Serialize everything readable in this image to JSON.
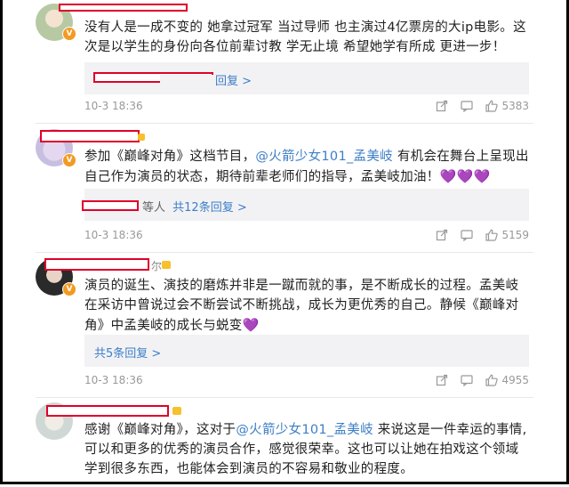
{
  "comments": [
    {
      "text": "没有人是一成不变的 她拿过冠军 当过导师 也主演过4亿票房的大ip电影。这次是以学生的身份向各位前辈讨教 学无止境 希望她学有所成 更进一步！",
      "reply_link": "等人 共79条回复 >",
      "time": "10-3 18:36",
      "likes": "5383"
    },
    {
      "text_pre": "参加《巅峰对角》这档节目，",
      "mention": "@火箭少女101_孟美岐",
      "text_post": " 有机会在舞台上呈现出自己作为演员的状态，期待前辈老师们的指导，孟美岐加油！",
      "hearts": "💜💜💜",
      "reply_prefix": "等人",
      "reply_link": "共12条回复 >",
      "time": "10-3 18:36",
      "likes": "5159"
    },
    {
      "name_frag": "尔",
      "text": "演员的诞生、演技的磨炼并非是一蹴而就的事，是不断成长的过程。孟美岐在采访中曾说过会不断尝试不断挑战，成长为更优秀的自己。静候《巅峰对角》中孟美岐的成长与蜕变",
      "hearts": "💜",
      "reply_link": "共5条回复 >",
      "time": "10-3 18:36",
      "likes": "4955"
    },
    {
      "text_pre": "感谢《巅峰对角》，这对于",
      "mention": "@火箭少女101_孟美岐",
      "text_post": " 来说这是一件幸运的事情,可以和更多的优秀的演员合作，感觉很荣幸。这也可以让她在拍戏这个领域学到很多东西，也能体会到演员的不容易和敬业的程度。"
    }
  ],
  "colors": {
    "accent_link": "#3d7ec6",
    "mention": "#eb7350",
    "redaction": "#e0002a",
    "badge": "#f29a21"
  }
}
